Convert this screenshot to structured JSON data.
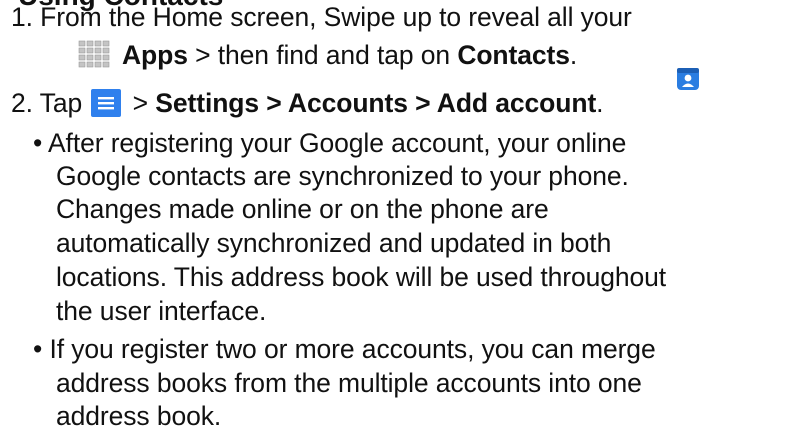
{
  "title_fragment": "Using Contacts",
  "step1": {
    "line1": "1.  From the Home screen, Swipe up to reveal all your",
    "apps_label": "Apps",
    "then_text": "  > then find and tap on ",
    "contacts_label": "Contacts",
    "period": "."
  },
  "step2": {
    "prefix": "2. Tap ",
    "sep": " > ",
    "path": "Settings > Accounts > Add account",
    "period": "."
  },
  "bullets": [
    {
      "lines": [
        "• After registering your Google account, your online",
        "Google contacts are synchronized to your phone.",
        "Changes made online or on the phone are",
        "automatically synchronized and updated in both",
        "locations. This address book will be used throughout",
        "the user interface."
      ]
    },
    {
      "lines": [
        "• If you register two or more accounts, you can merge",
        "address books from the multiple accounts into one",
        "address book."
      ]
    }
  ],
  "icons": {
    "apps": "apps-grid-icon",
    "contacts": "contacts-app-icon",
    "menu": "hamburger-menu-icon"
  },
  "colors": {
    "menu_blue": "#2f80ed",
    "contacts_blue": "#2a7de1",
    "grid_gray": "#b8b8b8"
  }
}
